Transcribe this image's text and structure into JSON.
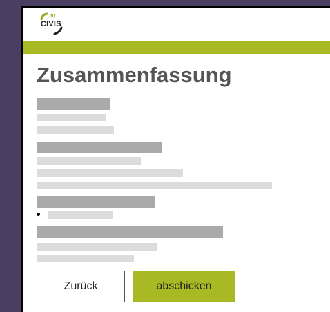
{
  "logo": {
    "small": "my",
    "main": "CIVIS"
  },
  "page": {
    "title": "Zusammenfassung"
  },
  "buttons": {
    "back": "Zurück",
    "submit": "abschicken"
  },
  "colors": {
    "accent": "#a9b923",
    "sidebar": "#4a3e63"
  }
}
